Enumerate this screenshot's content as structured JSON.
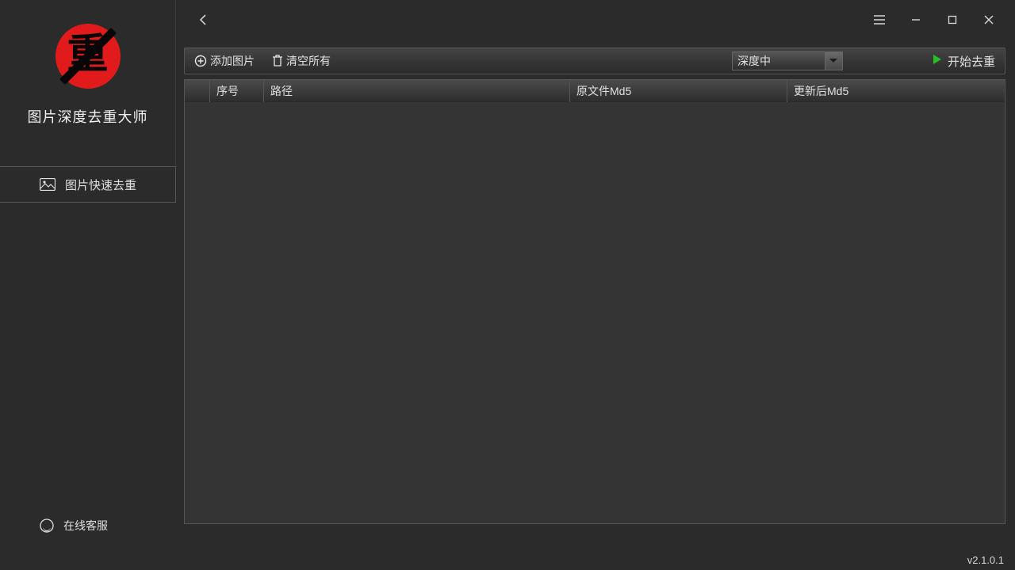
{
  "app": {
    "title": "图片深度去重大师",
    "logo_glyph": "重"
  },
  "sidebar": {
    "items": [
      {
        "label": "图片快速去重"
      }
    ],
    "support_label": "在线客服"
  },
  "toolbar": {
    "add_label": "添加图片",
    "clear_label": "清空所有",
    "depth_selected": "深度中",
    "start_label": "开始去重"
  },
  "table": {
    "columns": {
      "c0": "",
      "c1": "序号",
      "c2": "路径",
      "c3": "原文件Md5",
      "c4": "更新后Md5"
    }
  },
  "footer": {
    "version": "v2.1.0.1"
  }
}
